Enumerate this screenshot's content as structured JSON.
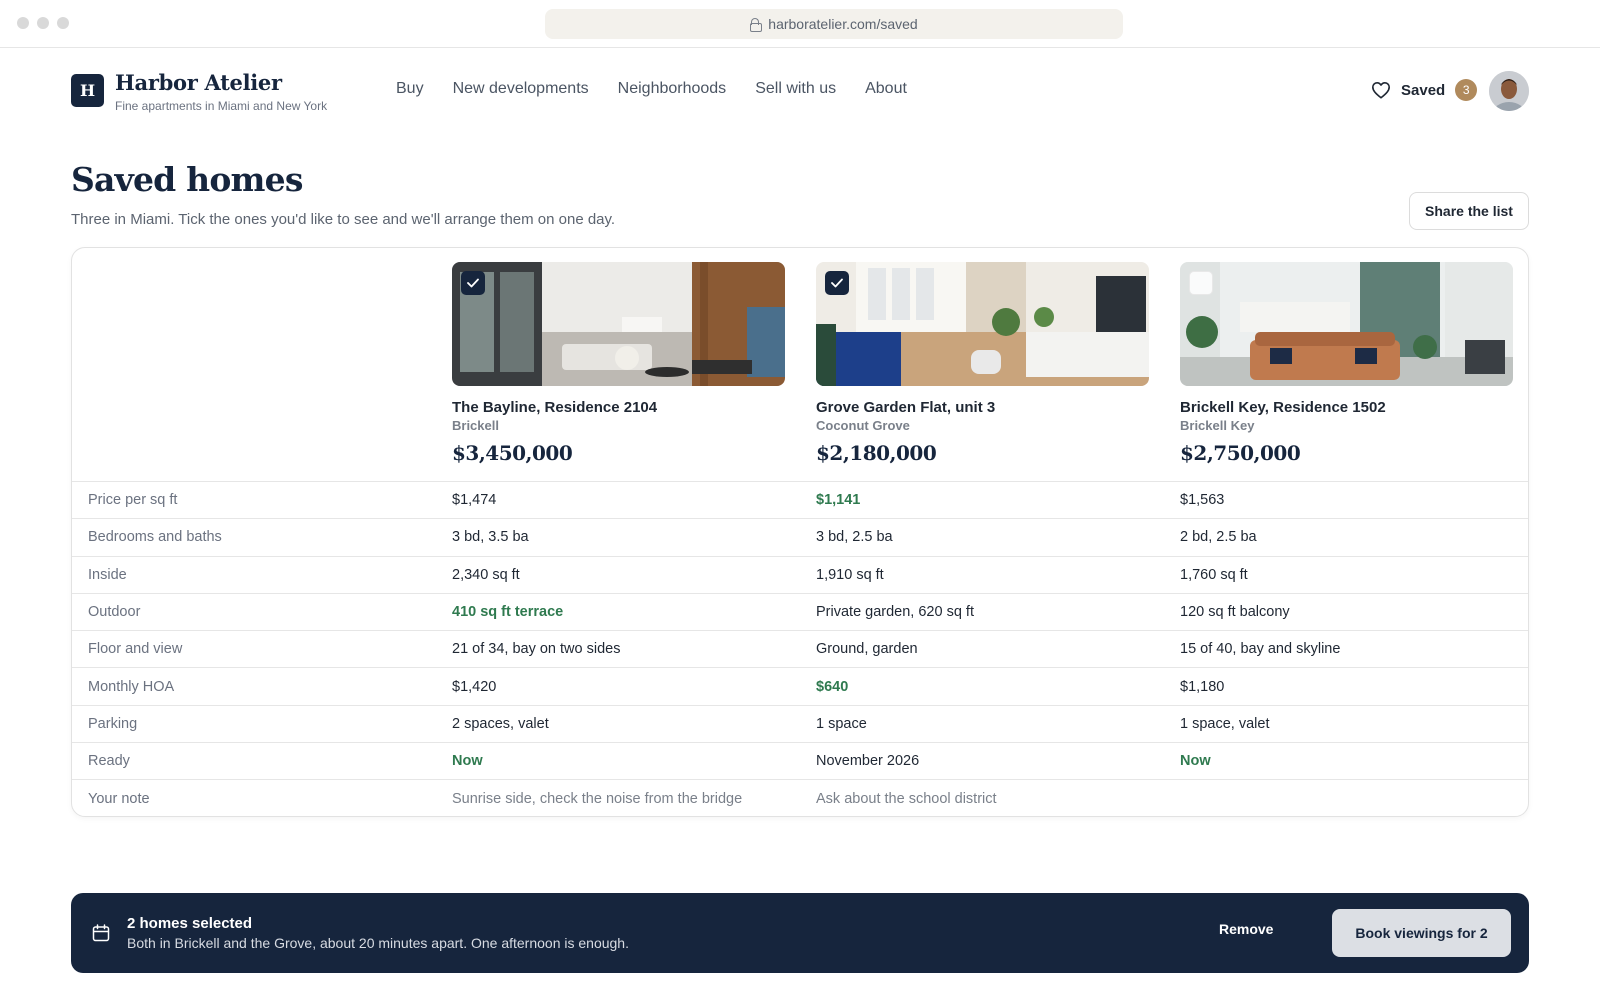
{
  "browser": {
    "url": "harboratelier.com/saved"
  },
  "brand": {
    "mark": "H",
    "name": "Harbor Atelier",
    "tagline": "Fine apartments in Miami and New York"
  },
  "nav": {
    "items": [
      "Buy",
      "New developments",
      "Neighborhoods",
      "Sell with us",
      "About"
    ]
  },
  "saved": {
    "label": "Saved",
    "count": "3",
    "icon": "heart-icon"
  },
  "page": {
    "title": "Saved homes",
    "subtitle": "Three in Miami. Tick the ones you'd like to see and we'll arrange them on one day.",
    "share_label": "Share the list"
  },
  "homes": [
    {
      "name": "The Bayline, Residence 2104",
      "area": "Brickell",
      "price": "$3,450,000",
      "selected": true
    },
    {
      "name": "Grove Garden Flat, unit 3",
      "area": "Coconut Grove",
      "price": "$2,180,000",
      "selected": true
    },
    {
      "name": "Brickell Key, Residence 1502",
      "area": "Brickell Key",
      "price": "$2,750,000",
      "selected": false
    }
  ],
  "rows": [
    {
      "label": "Price per sq ft",
      "values": [
        "$1,474",
        "$1,141",
        "$1,563"
      ],
      "highlight": [
        false,
        true,
        false
      ]
    },
    {
      "label": "Bedrooms and baths",
      "values": [
        "3 bd, 3.5 ba",
        "3 bd, 2.5 ba",
        "2 bd, 2.5 ba"
      ],
      "highlight": [
        false,
        false,
        false
      ]
    },
    {
      "label": "Inside",
      "values": [
        "2,340 sq ft",
        "1,910 sq ft",
        "1,760 sq ft"
      ],
      "highlight": [
        false,
        false,
        false
      ]
    },
    {
      "label": "Outdoor",
      "values": [
        "410 sq ft terrace",
        "Private garden, 620 sq ft",
        "120 sq ft balcony"
      ],
      "highlight": [
        true,
        false,
        false
      ]
    },
    {
      "label": "Floor and view",
      "values": [
        "21 of 34, bay on two sides",
        "Ground, garden",
        "15 of 40, bay and skyline"
      ],
      "highlight": [
        false,
        false,
        false
      ]
    },
    {
      "label": "Monthly HOA",
      "values": [
        "$1,420",
        "$640",
        "$1,180"
      ],
      "highlight": [
        false,
        true,
        false
      ]
    },
    {
      "label": "Parking",
      "values": [
        "2 spaces, valet",
        "1 space",
        "1 space, valet"
      ],
      "highlight": [
        false,
        false,
        false
      ]
    },
    {
      "label": "Ready",
      "values": [
        "Now",
        "November 2026",
        "Now"
      ],
      "highlight": [
        true,
        false,
        true
      ]
    },
    {
      "label": "Your note",
      "values": [
        "Sunrise side, check the noise from the bridge",
        "Ask about the school district",
        ""
      ],
      "highlight": [
        false,
        false,
        false
      ]
    }
  ],
  "selection_bar": {
    "title": "2 homes selected",
    "subtitle": "Both in Brickell and the Grove, about 20 minutes apart. One afternoon is enough.",
    "remove_label": "Remove",
    "book_label": "Book viewings for 2",
    "icon": "calendar-icon"
  },
  "colors": {
    "navy": "#16253d",
    "accent_green": "#2f7a4f",
    "badge_gold": "#b08a5c"
  }
}
